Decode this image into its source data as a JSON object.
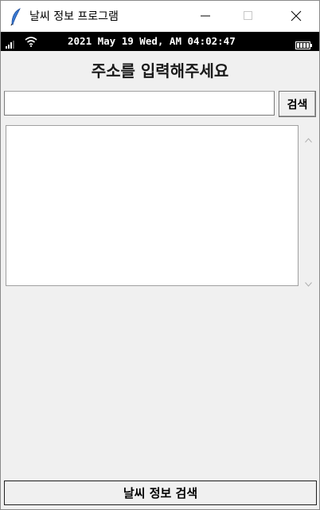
{
  "window": {
    "title": "날씨 정보 프로그램",
    "icon": "feather-icon"
  },
  "status_bar": {
    "datetime": "2021 May 19 Wed, AM 04:02:47",
    "icons": [
      "signal-icon",
      "wifi-icon",
      "battery-icon"
    ]
  },
  "main": {
    "prompt_label": "주소를 입력해주세요",
    "address_input": {
      "value": "",
      "placeholder": ""
    },
    "search_button_label": "검색",
    "result_text": ""
  },
  "footer": {
    "weather_search_button_label": "날씨 정보 검색"
  }
}
